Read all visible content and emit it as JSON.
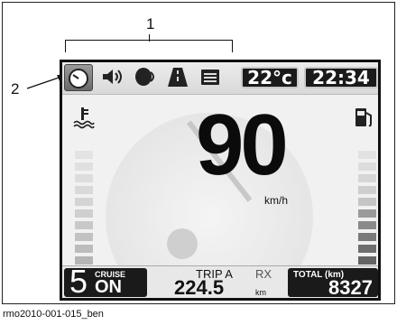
{
  "callouts": {
    "one": "1",
    "two": "2"
  },
  "topbar": {
    "tabs": [
      {
        "icon": "speedometer-icon",
        "selected": true
      },
      {
        "icon": "speaker-icon",
        "selected": false
      },
      {
        "icon": "phone-headset-icon",
        "selected": false
      },
      {
        "icon": "road-icon",
        "selected": false
      },
      {
        "icon": "menu-list-icon",
        "selected": false
      }
    ],
    "temperature": "22°c",
    "time": "22:34"
  },
  "display": {
    "speed": "90",
    "speed_unit": "km/h"
  },
  "gauges": {
    "coolant_icon": "coolant-temperature-icon",
    "fuel_icon": "fuel-pump-icon",
    "coolant_bar_colors": [
      "#e3e3e3",
      "#e0e0e0",
      "#dddddd",
      "#d9d9d9",
      "#d4d4d4",
      "#cfcfcf",
      "#c8c8c8",
      "#c2c2c2",
      "#bcbcbc",
      "#b5b5b5",
      "#aeaeae",
      "#a8a8a8"
    ],
    "fuel_bar_colors": [
      "#e2e2e2",
      "#dddddd",
      "#d6d6d6",
      "#cecece",
      "#c5c5c5",
      "#9a9a9a",
      "#8a8a8a",
      "#7a7a7a",
      "#6e6e6e",
      "#646464",
      "#5c5c5c",
      "#555555"
    ]
  },
  "bottombar": {
    "gear": "5",
    "cruise_label": "CRUISE",
    "cruise_state": "ON",
    "trip_label": "TRIP A",
    "rx_label": "RX",
    "trip_value": "224.5",
    "trip_unit": "km",
    "total_label": "TOTAL (km)",
    "total_value": "8327"
  },
  "caption": "rmo2010-001-015_ben"
}
